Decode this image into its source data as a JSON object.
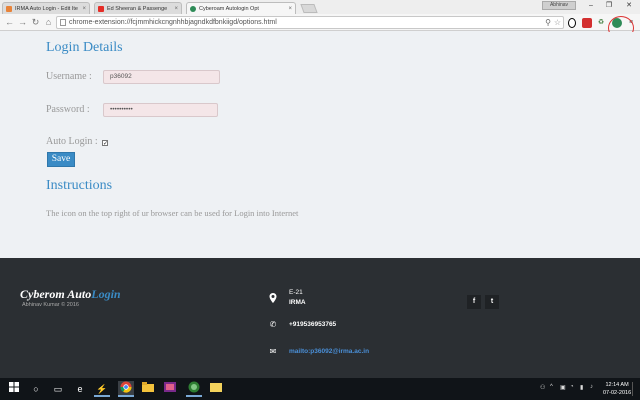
{
  "browser": {
    "tabs": [
      {
        "label": "IRMA Auto Login - Edit Ite",
        "favicon_color": "#e8833a"
      },
      {
        "label": "Ed Sheeran & Passenge",
        "favicon_color": "#e52d27"
      },
      {
        "label": "Cyberoam Autologin Opt",
        "favicon_color": "#2e8b57"
      }
    ],
    "profile_label": "Abhinav",
    "url": "chrome-extension://fcjmmhickcngnhhbjagndkdfbnkiigd/options.html",
    "zoom_icon": "zoom-icon",
    "bookmark_icon": "star-icon"
  },
  "page": {
    "heading": "Login Details",
    "username_label": "Username :",
    "username_value": "p36092",
    "password_label": "Password :",
    "password_value": "••••••••••",
    "auto_login_label": "Auto Login :",
    "auto_login_checked": true,
    "save_label": "Save",
    "instructions_heading": "Instructions",
    "instructions_text": "The icon on the top right of ur browser can be used for Login into Internet",
    "accent_color": "#3a8bc5"
  },
  "footer": {
    "brand_part1": "Cyberom Auto",
    "brand_part2": "Login",
    "copyright": "Abhinav Kumar © 2016",
    "address_line1": "E-21",
    "address_line2": "IRMA",
    "phone": "+919536953765",
    "email_link": "mailto:p36092@irma.ac.in",
    "facebook_glyph": "f",
    "twitter_glyph": "t"
  },
  "taskbar": {
    "time": "12:14 AM",
    "date": "07-02-2016"
  }
}
